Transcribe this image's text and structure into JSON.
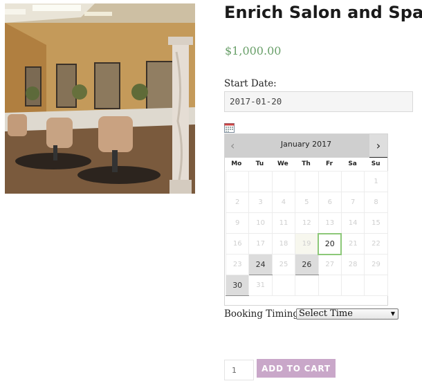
{
  "product": {
    "title": "Enrich Salon and Spa",
    "price": "$1,000.00",
    "image_alt": "salon interior photo"
  },
  "booking": {
    "start_date_label": "Start Date:",
    "start_date_value": "2017-01-20",
    "calendar_icon": "calendar-icon"
  },
  "calendar": {
    "month_label": "January 2017",
    "prev_icon": "chevron-left-icon",
    "next_icon": "chevron-right-icon",
    "prev_glyph": "‹",
    "next_glyph": "›",
    "weekdays": [
      "Mo",
      "Tu",
      "We",
      "Th",
      "Fr",
      "Sa",
      "Su"
    ],
    "weeks": [
      [
        {
          "d": ""
        },
        {
          "d": ""
        },
        {
          "d": ""
        },
        {
          "d": ""
        },
        {
          "d": ""
        },
        {
          "d": ""
        },
        {
          "d": "1",
          "s": "disabled"
        }
      ],
      [
        {
          "d": "2",
          "s": "disabled"
        },
        {
          "d": "3",
          "s": "disabled"
        },
        {
          "d": "4",
          "s": "disabled"
        },
        {
          "d": "5",
          "s": "disabled"
        },
        {
          "d": "6",
          "s": "disabled"
        },
        {
          "d": "7",
          "s": "disabled"
        },
        {
          "d": "8",
          "s": "disabled"
        }
      ],
      [
        {
          "d": "9",
          "s": "disabled"
        },
        {
          "d": "10",
          "s": "disabled"
        },
        {
          "d": "11",
          "s": "disabled"
        },
        {
          "d": "12",
          "s": "disabled"
        },
        {
          "d": "13",
          "s": "disabled"
        },
        {
          "d": "14",
          "s": "disabled"
        },
        {
          "d": "15",
          "s": "disabled"
        }
      ],
      [
        {
          "d": "16",
          "s": "disabled"
        },
        {
          "d": "17",
          "s": "disabled"
        },
        {
          "d": "18",
          "s": "disabled"
        },
        {
          "d": "19",
          "s": "today"
        },
        {
          "d": "20",
          "s": "selected"
        },
        {
          "d": "21",
          "s": "disabled"
        },
        {
          "d": "22",
          "s": "disabled"
        }
      ],
      [
        {
          "d": "23",
          "s": "disabled"
        },
        {
          "d": "24",
          "s": "available"
        },
        {
          "d": "25",
          "s": "disabled"
        },
        {
          "d": "26",
          "s": "available"
        },
        {
          "d": "27",
          "s": "disabled"
        },
        {
          "d": "28",
          "s": "disabled"
        },
        {
          "d": "29",
          "s": "disabled"
        }
      ],
      [
        {
          "d": "30",
          "s": "available"
        },
        {
          "d": "31",
          "s": "disabled"
        },
        {
          "d": ""
        },
        {
          "d": ""
        },
        {
          "d": ""
        },
        {
          "d": ""
        },
        {
          "d": ""
        }
      ]
    ]
  },
  "timing": {
    "label": "Booking Timing:",
    "selected": "Select Time"
  },
  "cart": {
    "quantity": "1",
    "button_label": "ADD TO CART"
  },
  "colors": {
    "price": "#6aa06a",
    "button": "#c9a7c9",
    "selected_day_border": "#8cc878"
  }
}
